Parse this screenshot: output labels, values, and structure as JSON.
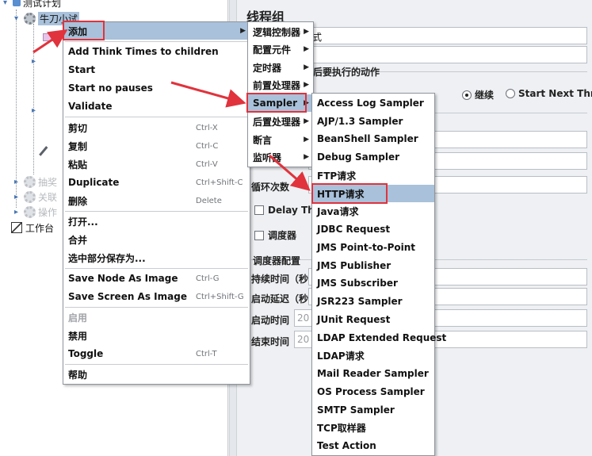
{
  "tree": {
    "root_label": "测试计划",
    "selected_label": "牛刀小试",
    "faded_label_1": "抽奖",
    "faded_label_2": "关联",
    "faded_label_3": "操作",
    "workbench_label": "工作台"
  },
  "right_panel": {
    "title": "线程组",
    "name_value": "式",
    "error_action_label": "后要执行的动作",
    "radio_continue": "继续",
    "radio_start_next": "Start Next Thr",
    "loop_label": "循环次数",
    "delay_label": "Delay Thr",
    "scheduler_label": "调度器",
    "scheduler_config_label": "调度器配置",
    "duration_label": "持续时间（秒",
    "startup_delay_label": "启动延迟（秒",
    "start_time_label": "启动时间",
    "start_time_value": "20",
    "end_time_label": "结束时间",
    "end_time_value": "20"
  },
  "context_menu": {
    "items": [
      {
        "label": "添加",
        "shortcut": ""
      },
      {
        "label": "Add Think Times to children",
        "shortcut": ""
      },
      {
        "label": "Start",
        "shortcut": ""
      },
      {
        "label": "Start no pauses",
        "shortcut": ""
      },
      {
        "label": "Validate",
        "shortcut": ""
      },
      {
        "label": "剪切",
        "shortcut": "Ctrl-X"
      },
      {
        "label": "复制",
        "shortcut": "Ctrl-C"
      },
      {
        "label": "粘贴",
        "shortcut": "Ctrl-V"
      },
      {
        "label": "Duplicate",
        "shortcut": "Ctrl+Shift-C"
      },
      {
        "label": "删除",
        "shortcut": "Delete"
      },
      {
        "label": "打开...",
        "shortcut": ""
      },
      {
        "label": "合并",
        "shortcut": ""
      },
      {
        "label": "选中部分保存为...",
        "shortcut": ""
      },
      {
        "label": "Save Node As Image",
        "shortcut": "Ctrl-G"
      },
      {
        "label": "Save Screen As Image",
        "shortcut": "Ctrl+Shift-G"
      },
      {
        "label": "启用",
        "shortcut": ""
      },
      {
        "label": "禁用",
        "shortcut": ""
      },
      {
        "label": "Toggle",
        "shortcut": "Ctrl-T"
      },
      {
        "label": "帮助",
        "shortcut": ""
      }
    ]
  },
  "add_submenu": {
    "items": [
      {
        "label": "逻辑控制器"
      },
      {
        "label": "配置元件"
      },
      {
        "label": "定时器"
      },
      {
        "label": "前置处理器"
      },
      {
        "label": "Sampler"
      },
      {
        "label": "后置处理器"
      },
      {
        "label": "断言"
      },
      {
        "label": "监听器"
      }
    ]
  },
  "sampler_submenu": {
    "items": [
      {
        "label": "Access Log Sampler"
      },
      {
        "label": "AJP/1.3 Sampler"
      },
      {
        "label": "BeanShell Sampler"
      },
      {
        "label": "Debug Sampler"
      },
      {
        "label": "FTP请求"
      },
      {
        "label": "HTTP请求"
      },
      {
        "label": "Java请求"
      },
      {
        "label": "JDBC Request"
      },
      {
        "label": "JMS Point-to-Point"
      },
      {
        "label": "JMS Publisher"
      },
      {
        "label": "JMS Subscriber"
      },
      {
        "label": "JSR223 Sampler"
      },
      {
        "label": "JUnit Request"
      },
      {
        "label": "LDAP Extended Request"
      },
      {
        "label": "LDAP请求"
      },
      {
        "label": "Mail Reader Sampler"
      },
      {
        "label": "OS Process Sampler"
      },
      {
        "label": "SMTP Sampler"
      },
      {
        "label": "TCP取样器"
      },
      {
        "label": "Test Action"
      }
    ]
  },
  "colors": {
    "highlight": "#e0333d",
    "selection": "#a9c1da"
  }
}
